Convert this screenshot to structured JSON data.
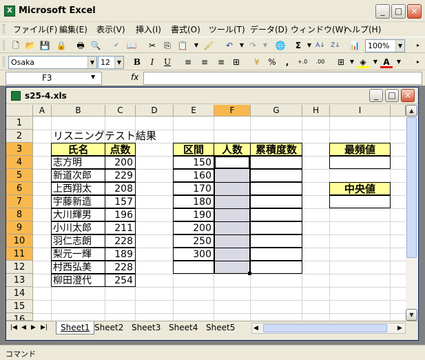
{
  "app": {
    "title": "Microsoft Excel",
    "icon": "excel-icon"
  },
  "window_buttons": {
    "minimize": "_",
    "maximize": "□",
    "close": "×"
  },
  "menu": [
    "ファイル(F)",
    "編集(E)",
    "表示(V)",
    "挿入(I)",
    "書式(O)",
    "ツール(T)",
    "データ(D)",
    "ウィンドウ(W)",
    "ヘルプ(H)"
  ],
  "toolbar": {
    "zoom": "100%"
  },
  "format": {
    "font": "Osaka",
    "size": "12",
    "bold": "B",
    "italic": "I",
    "underline": "U",
    "percent": "%",
    "comma": ",",
    "inc_dec": "+.0",
    "dec_dec": ".00"
  },
  "formula_bar": {
    "name_box": "F3",
    "fx": "fx",
    "value": ""
  },
  "workbook": {
    "title": "s25-4.xls"
  },
  "columns": [
    "A",
    "B",
    "C",
    "D",
    "E",
    "F",
    "G",
    "H",
    "I"
  ],
  "rows": [
    "1",
    "2",
    "3",
    "4",
    "5",
    "6",
    "7",
    "8",
    "9",
    "10",
    "11",
    "12",
    "13",
    "14",
    "15",
    "16"
  ],
  "sheet": {
    "title": "リスニングテスト結果",
    "hdr_name": "氏名",
    "hdr_score": "点数",
    "hdr_interval": "区間",
    "hdr_count": "人数",
    "hdr_cumfreq": "累積度数",
    "hdr_mode": "最頻値",
    "hdr_median": "中央値",
    "names": [
      "志方明",
      "新道次郎",
      "上西翔太",
      "宇藤新造",
      "大川輝男",
      "小川太郎",
      "羽仁志朗",
      "梨元一輝",
      "村西弘美",
      "柳田澄代"
    ],
    "scores": [
      "200",
      "229",
      "208",
      "157",
      "196",
      "211",
      "228",
      "189",
      "228",
      "254"
    ],
    "intervals": [
      "150",
      "160",
      "170",
      "180",
      "190",
      "200",
      "250",
      "300"
    ]
  },
  "tabs": [
    "Sheet1",
    "Sheet2",
    "Sheet3",
    "Sheet4",
    "Sheet5"
  ],
  "status": "コマンド",
  "colors": {
    "selected_header": "#f9b84e",
    "header_fill": "#ffff99",
    "selection": "#d9d9e4"
  }
}
